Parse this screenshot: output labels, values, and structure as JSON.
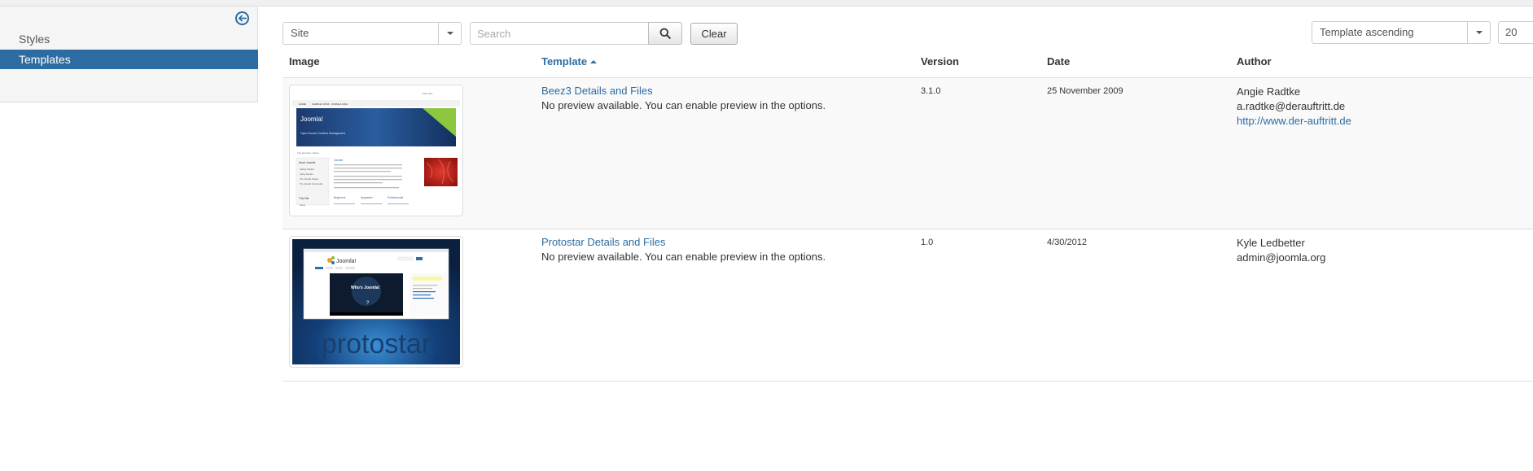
{
  "sidebar": {
    "collapse_icon": "arrow-left-circle-icon",
    "items": [
      {
        "label": "Styles",
        "active": false
      },
      {
        "label": "Templates",
        "active": true
      }
    ]
  },
  "filters": {
    "client_select": "Site",
    "search_placeholder": "Search",
    "search_value": "",
    "search_icon": "search-icon",
    "clear_label": "Clear",
    "ordering_select": "Template ascending",
    "limit_select": "20"
  },
  "table": {
    "columns": [
      "Image",
      "Template",
      "Version",
      "Date",
      "Author"
    ],
    "sorted_column": "Template",
    "rows": [
      {
        "template_link": "Beez3 Details and Files",
        "note": "No preview available. You can enable preview in the options.",
        "version": "3.1.0",
        "date": "25 November 2009",
        "author_name": "Angie Radtke",
        "author_email": "a.radtke@derauftritt.de",
        "author_url": "http://www.der-auftritt.de",
        "thumbnail": {
          "brand": "Joomla!",
          "tagline": "Open Source Content Management",
          "menu": [
            "HOME",
            "SAMPLE SITES",
            "JOOMLA.ORG"
          ],
          "top_links": [
            "Font size:",
            "Bigger",
            "Reset",
            "Smaller",
            "Search"
          ],
          "breadcrumb": "You are here: Home",
          "about_title": "About Joomla!",
          "about_items": [
            "Getting Started",
            "Using Joomla!",
            "The Joomla! Project",
            "The Joomla! Community"
          ],
          "site_title": "This Site",
          "site_items": [
            "Home"
          ],
          "article_title": "Joomla!",
          "columns": [
            "Beginners",
            "Upgraders",
            "Professionals"
          ],
          "accent": "#8dc63f"
        }
      },
      {
        "template_link": "Protostar Details and Files",
        "note": "No preview available. You can enable preview in the options.",
        "version": "1.0",
        "date": "4/30/2012",
        "author_name": "Kyle Ledbetter",
        "author_email": "admin@joomla.org",
        "thumbnail": {
          "brand": "Joomla!",
          "video_title": "Who's Joomla!",
          "wordmark": "protostar"
        }
      }
    ]
  },
  "colors": {
    "accent": "#2d6ca2",
    "row_alt": "#f9f9f9",
    "border": "#dddddd",
    "text": "#333333"
  }
}
